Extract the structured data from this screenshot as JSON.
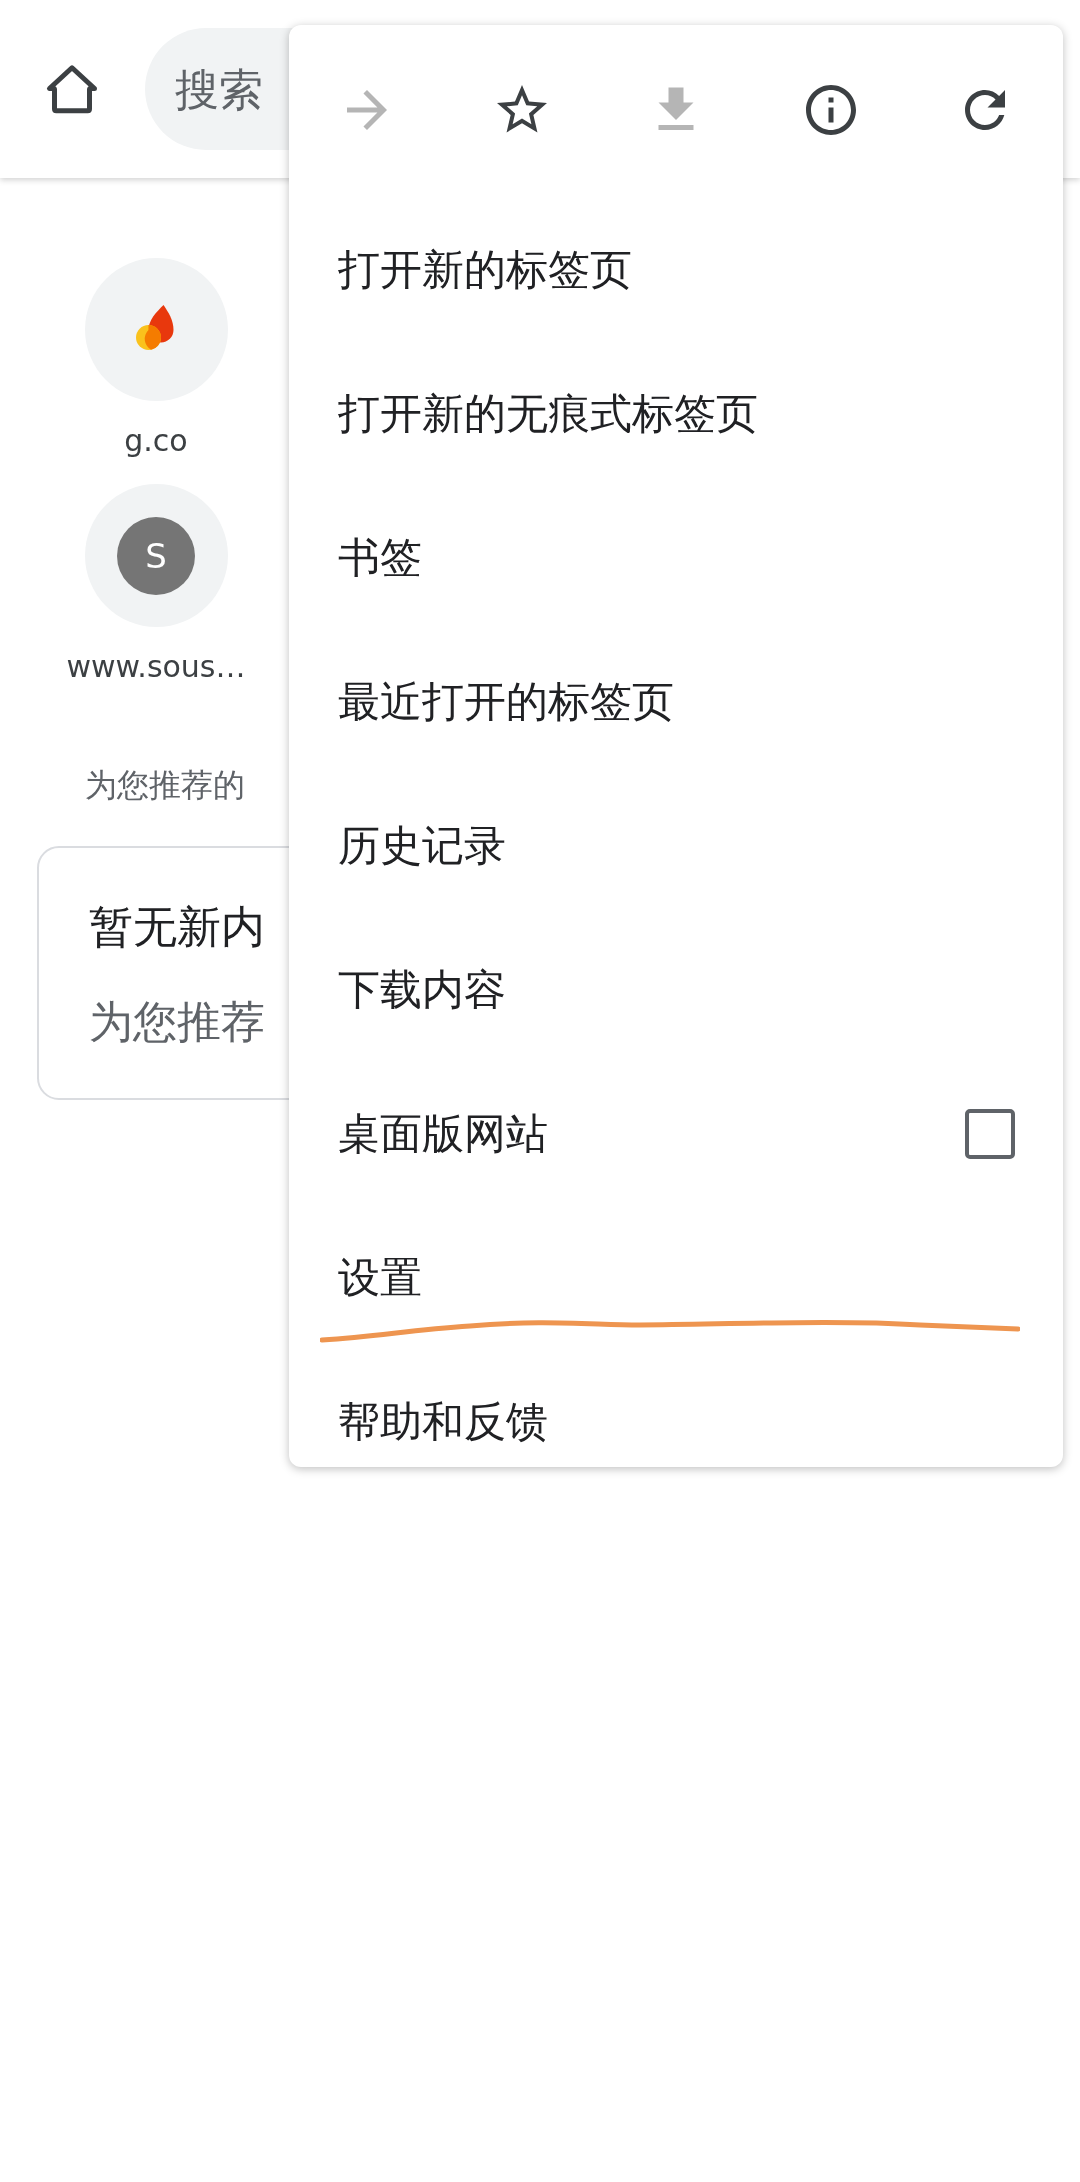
{
  "toolbar": {
    "search": {
      "placeholder": "搜索"
    }
  },
  "tiles": [
    {
      "label": "g.co",
      "kind": "flame"
    },
    {
      "label": "www.sous…",
      "kind": "letter",
      "letter": "S"
    }
  ],
  "feed": {
    "heading": "为您推荐的",
    "card": {
      "title": "暂无新内",
      "subtitle": "为您推荐"
    }
  },
  "menu": {
    "actions": [
      {
        "kind": "forward",
        "disabled": true
      },
      {
        "kind": "bookmark",
        "disabled": false
      },
      {
        "kind": "download",
        "disabled": true
      },
      {
        "kind": "info",
        "disabled": false
      },
      {
        "kind": "reload",
        "disabled": false
      }
    ],
    "items": [
      {
        "label": "打开新的标签页",
        "kind": "plain"
      },
      {
        "label": "打开新的无痕式标签页",
        "kind": "plain"
      },
      {
        "label": "书签",
        "kind": "plain"
      },
      {
        "label": "最近打开的标签页",
        "kind": "plain"
      },
      {
        "label": "历史记录",
        "kind": "plain"
      },
      {
        "label": "下载内容",
        "kind": "plain"
      },
      {
        "label": "桌面版网站",
        "kind": "checkbox",
        "checked": false
      },
      {
        "label": "设置",
        "kind": "plain"
      },
      {
        "label": "帮助和反馈",
        "kind": "plain"
      }
    ]
  }
}
